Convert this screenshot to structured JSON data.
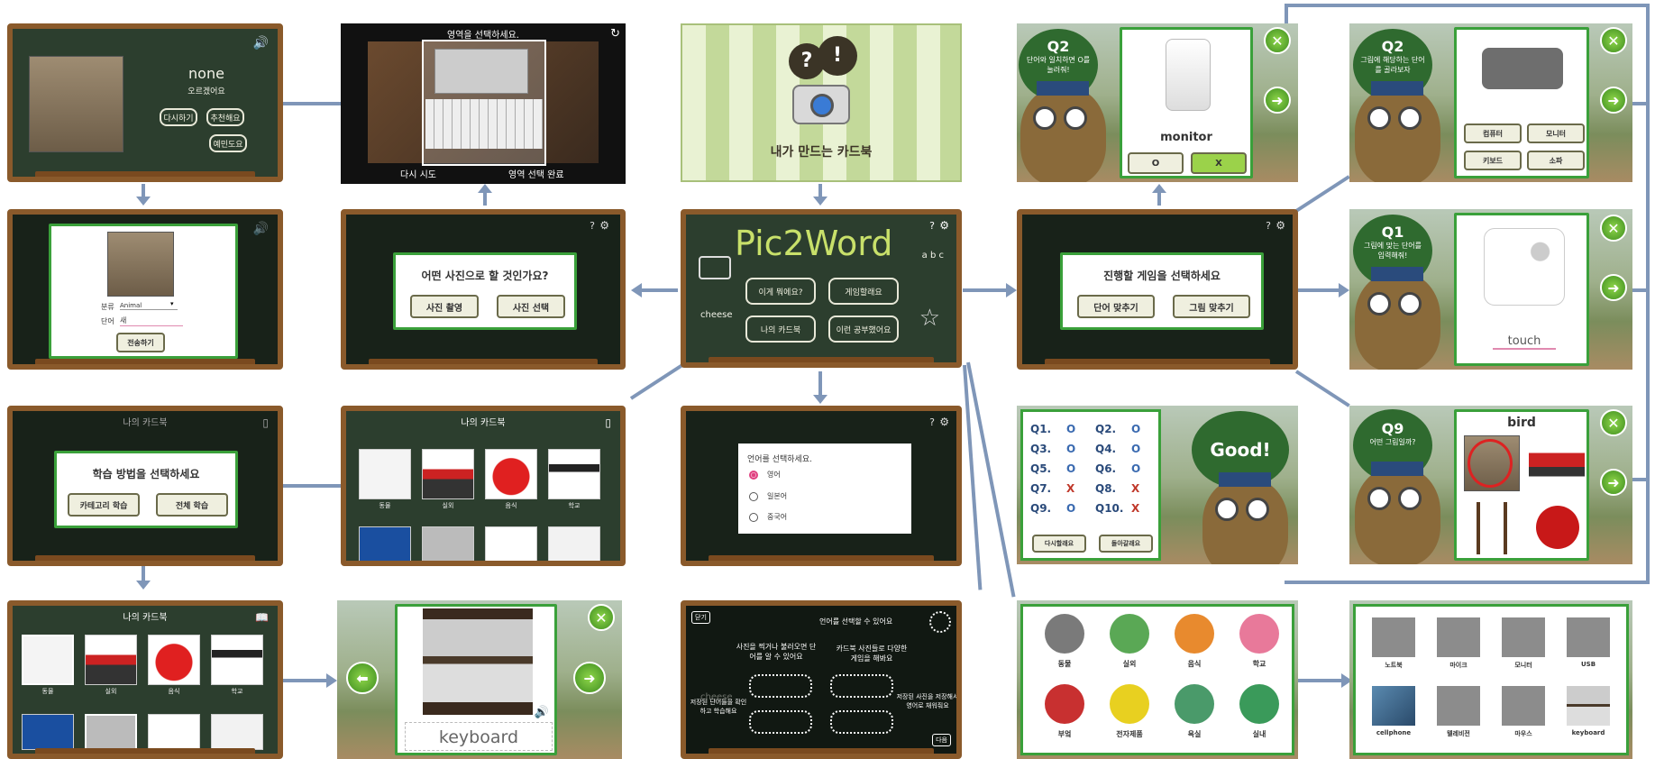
{
  "p1": {
    "word": "none",
    "meaning": "오르겠어요",
    "buttons": [
      "다시하기",
      "추천해요",
      "예민도요"
    ]
  },
  "p2": {
    "top": "영역을 선택하세요.",
    "left_btn": "다시 시도",
    "right_btn": "영역 선택 완료"
  },
  "p3": {
    "title": "내가 만드는 카드북"
  },
  "p4": {
    "q": "Q2",
    "bubble": "단어와 일치하면 O를 눌러줘!",
    "word": "monitor",
    "o": "O",
    "x": "X"
  },
  "p5": {
    "q": "Q2",
    "bubble": "그림에 해당하는 단어를 골라보자",
    "choices": [
      "컴퓨터",
      "모니터",
      "키보드",
      "소파"
    ]
  },
  "p6": {
    "category_label": "분류",
    "category_value": "Animal",
    "word_label": "단어",
    "word_value": "새",
    "send": "전송하기"
  },
  "p7": {
    "title": "어떤 사진으로 할 것인가요?",
    "b1": "사진 촬영",
    "b2": "사진 선택"
  },
  "p8": {
    "logo": "Pic2Word",
    "menu": [
      "이게 뭐에요?",
      "게임할래요",
      "나의 카드북",
      "이런 공부했어요"
    ],
    "cheese": "cheese",
    "abc": "a b c"
  },
  "p9": {
    "title": "진행할 게임을 선택하세요",
    "b1": "단어 맞추기",
    "b2": "그림 맞추기"
  },
  "p10": {
    "q": "Q1",
    "bubble": "그림에 맞는 단어를 입력해줘!",
    "answer": "touch"
  },
  "p11": {
    "title": "학습 방법을 선택하세요",
    "b1": "카테고리 학습",
    "b2": "전체 학습",
    "header": "나의 카드북"
  },
  "p12": {
    "header": "나의 카드북",
    "labels": [
      "동물",
      "실외",
      "음식",
      "학교"
    ]
  },
  "p13": {
    "title": "언어를 선택하세요.",
    "options": [
      "영어",
      "일본어",
      "중국어"
    ]
  },
  "p14": {
    "scores": [
      "Q1.",
      "Q2.",
      "Q3.",
      "Q4.",
      "Q5.",
      "Q6.",
      "Q7.",
      "Q8.",
      "Q9.",
      "Q10."
    ],
    "marks": [
      "O",
      "O",
      "O",
      "O",
      "O",
      "O",
      "X",
      "X",
      "O",
      "X"
    ],
    "good": "Good!",
    "b1": "다시할래요",
    "b2": "돌아갈래요"
  },
  "p15": {
    "q": "Q9",
    "bubble": "어떤 그림일까?",
    "word": "bird"
  },
  "p16": {
    "header": "나의 카드북",
    "labels": [
      "동물",
      "실외",
      "음식",
      "학교"
    ]
  },
  "p17": {
    "word": "keyboard"
  },
  "p18": {
    "close": "닫기",
    "next": "다음",
    "tips": [
      "언어를 선택할 수 있어요",
      "사진을 찍거나 불러오면 단어를 알 수 있어요",
      "카드북 사진들로 다양한 게임을 해봐요",
      "저장된 단어들을 확인하고 학습해요",
      "저장된 사진을 저장해서 영어로 채워줘요"
    ],
    "cheese": "cheese"
  },
  "p19": {
    "categories": [
      "동물",
      "실외",
      "음식",
      "학교",
      "부엌",
      "전자제품",
      "욕실",
      "실내"
    ]
  },
  "p20": {
    "labels": [
      "노트북",
      "마이크",
      "모니터",
      "USB",
      "cellphone",
      "텔레비전",
      "마우스",
      "keyboard"
    ]
  }
}
